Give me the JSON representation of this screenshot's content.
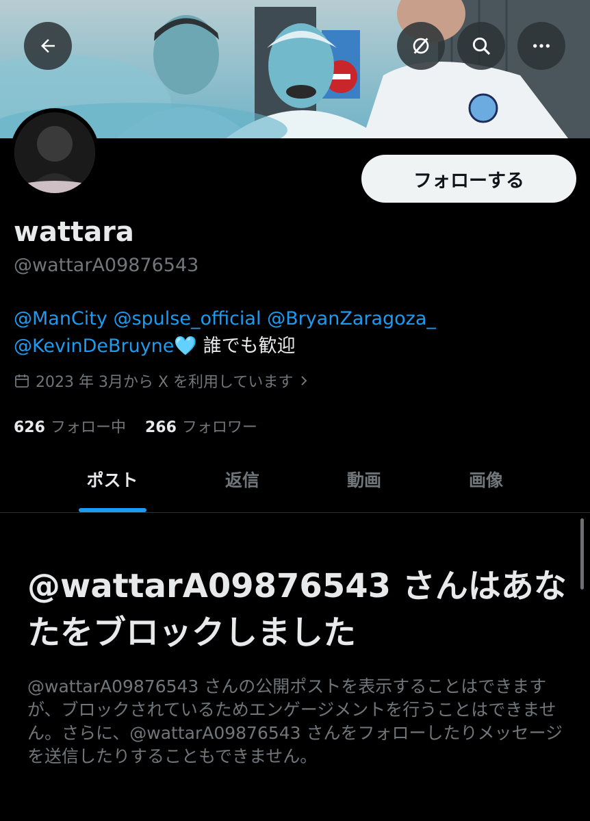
{
  "header": {
    "back_icon": "arrow-left-icon",
    "grok_icon": "slash-circle-icon",
    "search_icon": "search-icon",
    "more_icon": "more-horizontal-icon",
    "banner_sign_text": "NO ENTRY"
  },
  "profile": {
    "follow_button_label": "フォローする",
    "display_name": "wattara",
    "handle": "@wattarA09876543",
    "bio": {
      "mentions_line1": [
        "@ManCity",
        "@spulse_official",
        "@BryanZaragoza_"
      ],
      "mention_line2": "@KevinDeBruyne",
      "emoji": "🩵",
      "text": "誰でも歓迎"
    },
    "joined": "2023 年 3月から X を利用しています",
    "following_count": "626",
    "following_label": "フォロー中",
    "followers_count": "266",
    "followers_label": "フォロワー"
  },
  "tabs": [
    {
      "label": "ポスト",
      "active": true
    },
    {
      "label": "返信",
      "active": false
    },
    {
      "label": "動画",
      "active": false
    },
    {
      "label": "画像",
      "active": false
    }
  ],
  "blocked": {
    "title": "@wattarA09876543 さんはあなたをブロックしました",
    "description": "@wattarA09876543 さんの公開ポストを表示することはできますが、ブロックされているためエンゲージメントを行うことはできません。さらに、@wattarA09876543 さんをフォローしたりメッセージを送信したりすることもできません。"
  },
  "colors": {
    "background": "#000000",
    "accent": "#1d9bf0",
    "text_primary": "#e7e9ea",
    "text_secondary": "#71767b"
  }
}
